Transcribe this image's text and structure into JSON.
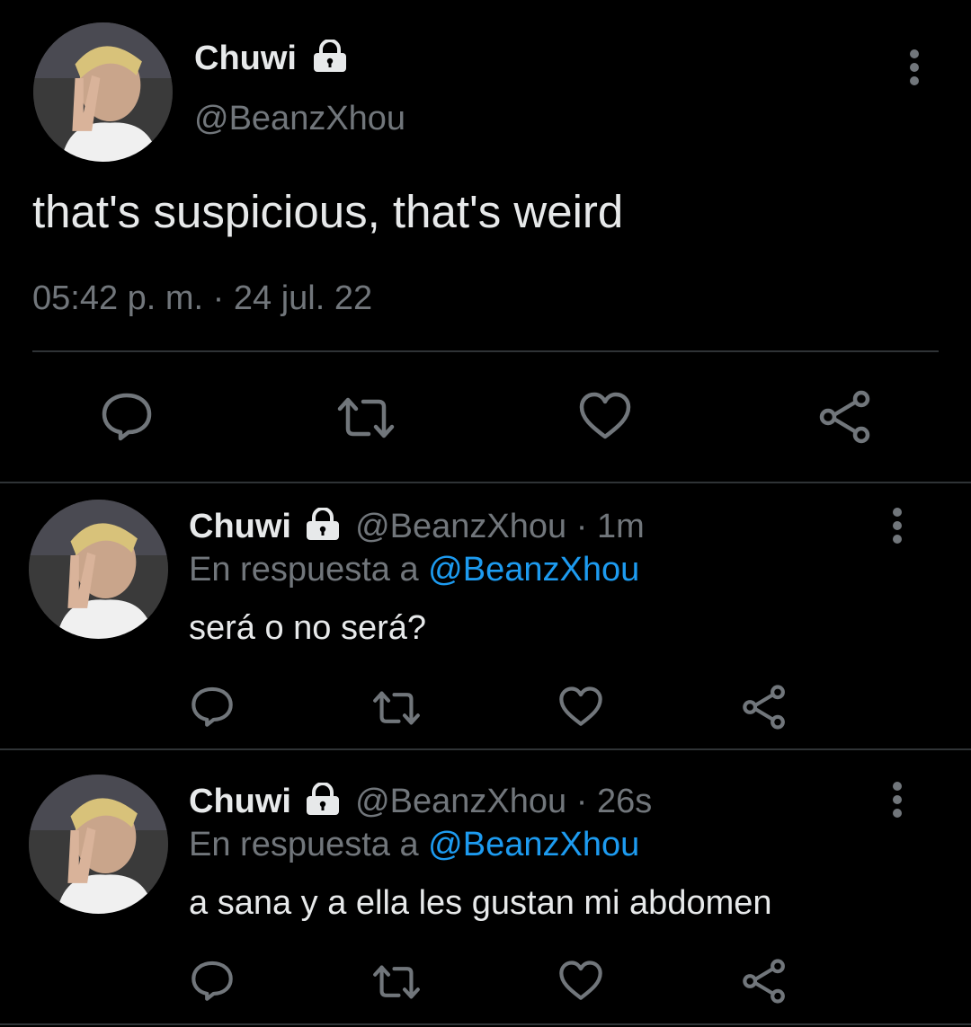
{
  "main_tweet": {
    "display_name": "Chuwi",
    "handle": "@BeanzXhou",
    "text": "that's suspicious, that's weird",
    "timestamp": "05:42 p. m. · 24 jul. 22",
    "avatar_icon": "profile-photo",
    "lock_icon": "lock-icon",
    "actions": [
      "reply-icon",
      "retweet-icon",
      "like-icon",
      "share-icon"
    ]
  },
  "replies": [
    {
      "display_name": "Chuwi",
      "handle": "@BeanzXhou",
      "separator": "·",
      "age": "1m",
      "reply_prefix": "En respuesta a",
      "reply_to": "@BeanzXhou",
      "text": "será o no será?"
    },
    {
      "display_name": "Chuwi",
      "handle": "@BeanzXhou",
      "separator": "·",
      "age": "26s",
      "reply_prefix": "En respuesta a",
      "reply_to": "@BeanzXhou",
      "text": "a sana y a ella les gustan mi abdomen"
    }
  ],
  "colors": {
    "background": "#000000",
    "text": "#e7e9ea",
    "muted": "#71767b",
    "link": "#1d9bf0",
    "divider": "#2f3336"
  }
}
